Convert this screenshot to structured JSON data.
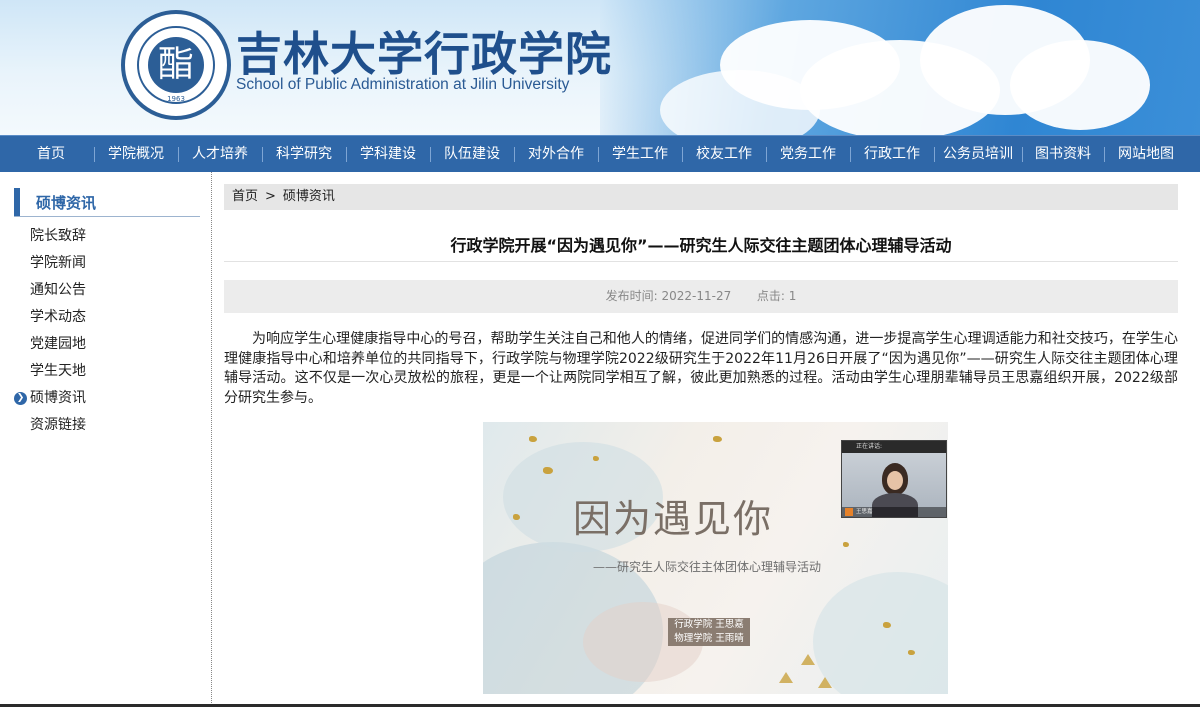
{
  "header": {
    "title_cn": "吉林大学行政学院",
    "title_en": "School of Public Administration at Jilin University",
    "logo_glyph": "酯",
    "logo_year": "1963"
  },
  "nav": {
    "items": [
      "首页",
      "学院概况",
      "人才培养",
      "科学研究",
      "学科建设",
      "队伍建设",
      "对外合作",
      "学生工作",
      "校友工作",
      "党务工作",
      "行政工作",
      "公务员培训",
      "图书资料",
      "网站地图"
    ]
  },
  "sidebar": {
    "heading": "硕博资讯",
    "items": [
      "院长致辞",
      "学院新闻",
      "通知公告",
      "学术动态",
      "党建园地",
      "学生天地",
      "硕博资讯",
      "资源链接"
    ],
    "active_index": 6
  },
  "breadcrumb": {
    "home": "首页",
    "separator": ">",
    "current": "硕博资讯"
  },
  "article": {
    "title": "行政学院开展“因为遇见你”——研究生人际交往主题团体心理辅导活动",
    "publish_label": "发布时间:",
    "publish_date": "2022-11-27",
    "clicks_label": "点击:",
    "clicks": "1",
    "paragraph": "为响应学生心理健康指导中心的号召，帮助学生关注自己和他人的情绪，促进同学们的情感沟通，进一步提高学生心理调适能力和社交技巧，在学生心理健康指导中心和培养单位的共同指导下，行政学院与物理学院2022级研究生于2022年11月26日开展了“因为遇见你”——研究生人际交往主题团体心理辅导活动。这不仅是一次心灵放松的旅程，更是一个让两院同学相互了解，彼此更加熟悉的过程。活动由学生心理朋辈辅导员王思嘉组织开展，2022级部分研究生参与。"
  },
  "photo": {
    "title": "因为遇见你",
    "subtitle": "——研究生人际交往主体团体心理辅导活动",
    "tag_line1": "行政学院 王思嘉",
    "tag_line2": "物理学院 王雨晴",
    "video_status": "正在讲话:",
    "video_name": "王思嘉"
  },
  "colors": {
    "nav_bg": "#2f67a8",
    "accent": "#2f67a8",
    "breadcrumb_bg": "#e6e6e6",
    "meta_bg": "#ececec"
  }
}
